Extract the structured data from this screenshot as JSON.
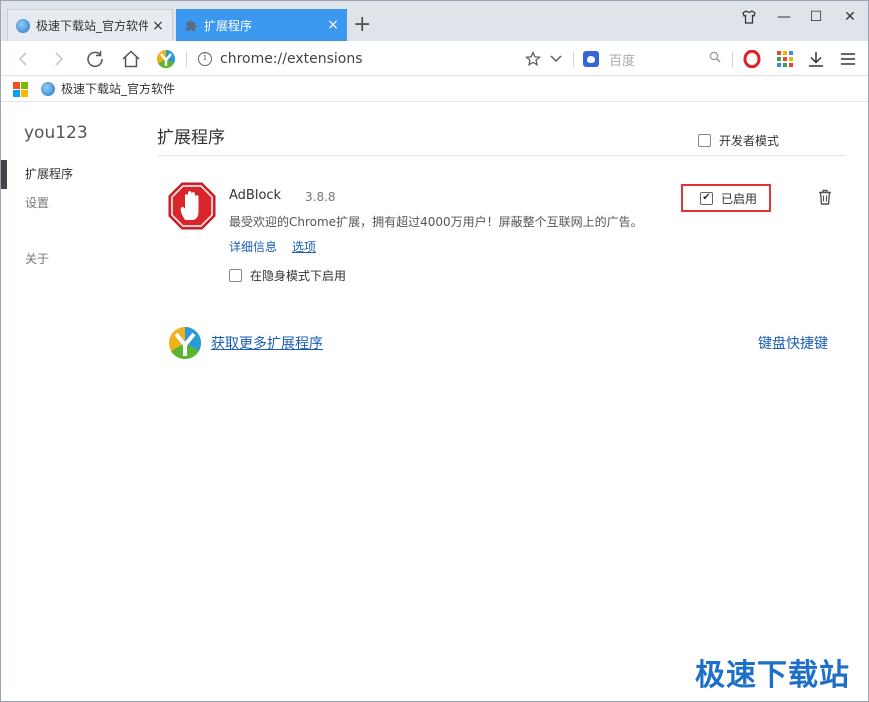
{
  "tabs": [
    {
      "label": "极速下载站_官方软件下载",
      "close": "×"
    },
    {
      "label": "扩展程序",
      "close": "×"
    }
  ],
  "new_tab_label": "+",
  "window_controls": {
    "minimize": "—",
    "maximize": "☐",
    "close": "✕"
  },
  "toolbar": {
    "url": "chrome://extensions",
    "search_placeholder": "百度"
  },
  "bookmarks": [
    {
      "label": "极速下载站_官方软件"
    }
  ],
  "sidebar": {
    "user": "you123",
    "items": [
      {
        "label": "扩展程序",
        "active": true
      },
      {
        "label": "设置",
        "active": false
      },
      {
        "label": "关于",
        "active": false
      }
    ]
  },
  "main": {
    "title": "扩展程序",
    "developer_mode": {
      "label": "开发者模式",
      "checked": false
    },
    "extension": {
      "name": "AdBlock",
      "version": "3.8.8",
      "description": "最受欢迎的Chrome扩展，拥有超过4000万用户！屏蔽整个互联网上的广告。",
      "details_link": "详细信息",
      "options_link": "选项",
      "incognito": {
        "label": "在隐身模式下启用",
        "checked": false
      },
      "enabled": {
        "label": "已启用",
        "checked": true
      }
    },
    "get_more_link": "获取更多扩展程序",
    "keyboard_shortcuts_link": "键盘快捷键"
  },
  "watermark": "极速下载站",
  "colors": {
    "tab_active": "#3c98ee",
    "link": "#1a5fb4",
    "highlight_border": "#e0333a",
    "adblock_red": "#d9262c"
  }
}
